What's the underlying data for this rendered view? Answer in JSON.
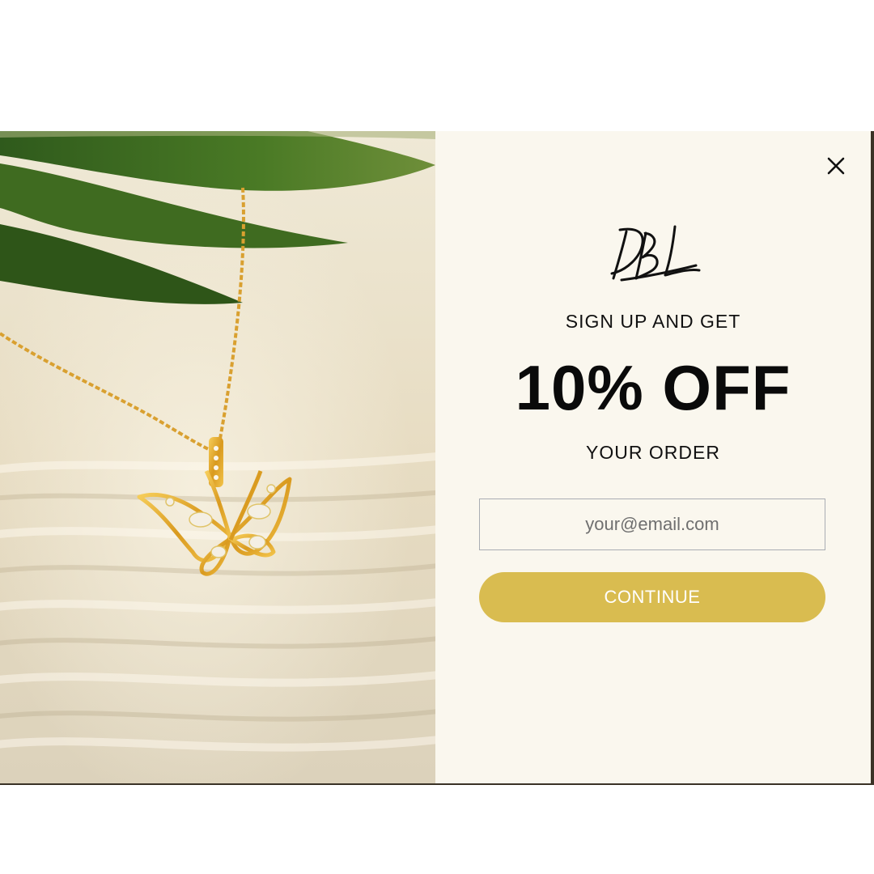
{
  "popup": {
    "logo_text": "DBL",
    "headline_top": "SIGN UP AND GET",
    "headline_big": "10% OFF",
    "headline_bottom": "YOUR ORDER",
    "email_placeholder": "your@email.com",
    "email_value": "",
    "continue_label": "CONTINUE",
    "close_icon": "close-icon"
  },
  "image": {
    "subject": "butterfly-necklace-photo"
  },
  "colors": {
    "panel_bg": "#faf7ee",
    "button_bg": "#d9bc50",
    "button_text": "#ffffff",
    "text": "#111111"
  }
}
